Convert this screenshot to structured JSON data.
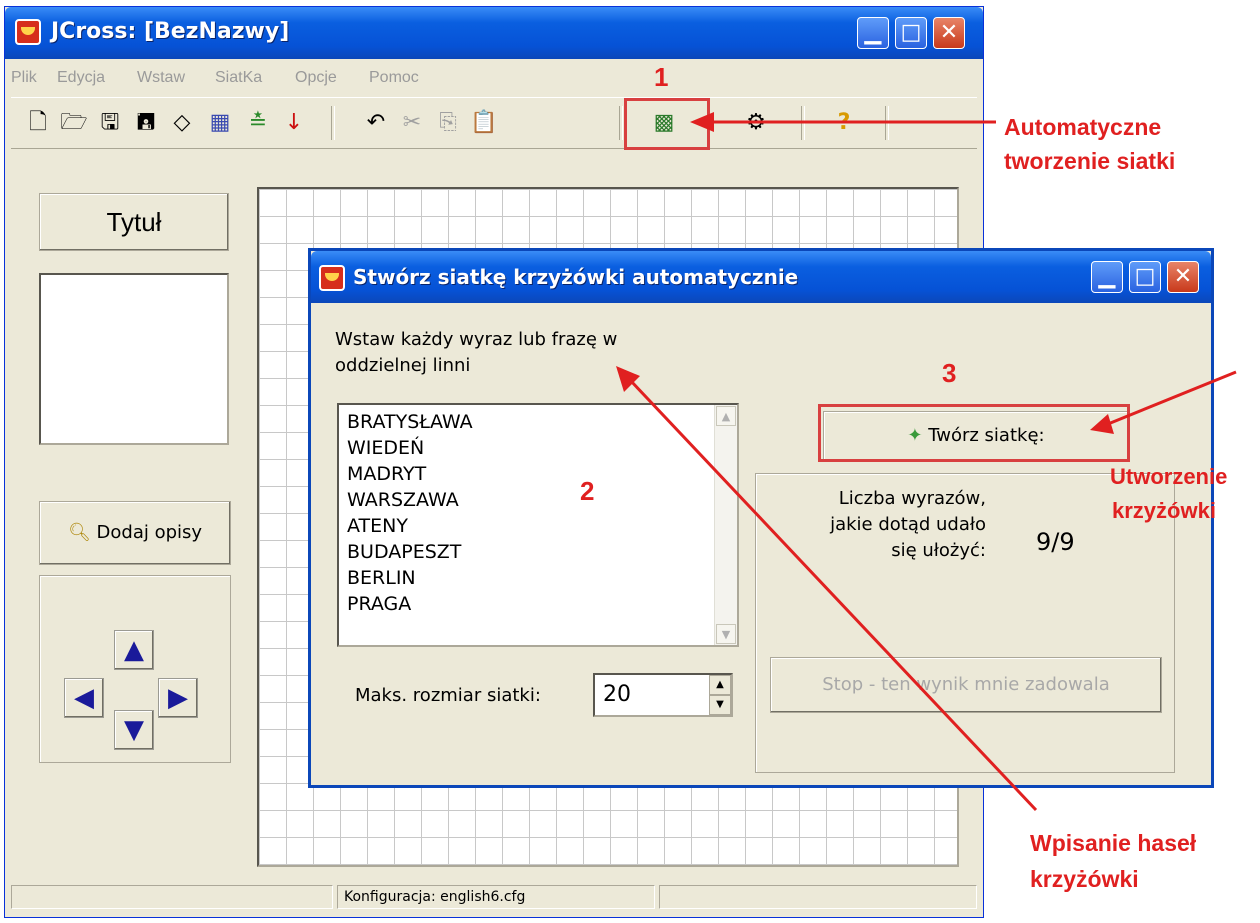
{
  "main_window": {
    "title": "JCross: [BezNazwy]",
    "menu": [
      "Plik",
      "Edycja",
      "Wstaw",
      "SiatKa",
      "Opcje",
      "Pomoc"
    ],
    "toolbar_icons": [
      "new-file-icon",
      "open-folder-icon",
      "save-icon",
      "save-as-icon",
      "eraser-icon",
      "grid-pattern-icon",
      "spacing-icon",
      "arrow-down-icon",
      "undo-icon",
      "cut-icon",
      "copy-icon",
      "paste-icon",
      "auto-grid-icon",
      "settings-icon",
      "help-icon"
    ],
    "title_button": "Tytuł",
    "add_descriptions_button": "Dodaj opisy",
    "status": "Konfiguracja: english6.cfg"
  },
  "dialog": {
    "title": "Stwórz siatkę krzyżówki automatycznie",
    "instructions_line1": "Wstaw każdy wyraz lub frazę w",
    "instructions_line2": "oddzielnej linni",
    "words": [
      "BRATYSŁAWA",
      "WIEDEŃ",
      "MADRYT",
      "WARSZAWA",
      "ATENY",
      "BUDAPESZT",
      "BERLIN",
      "PRAGA"
    ],
    "max_size_label": "Maks. rozmiar siatki:",
    "max_size_value": "20",
    "create_button": "Twórz siatkę:",
    "count_label_line1": "Liczba wyrazów,",
    "count_label_line2": "jakie dotąd udało",
    "count_label_line3": "się ułożyć:",
    "count_value": "9/9",
    "stop_button": "Stop - ten wynik mnie zadowala"
  },
  "annotations": {
    "step1": "1",
    "step2": "2",
    "step3": "3",
    "auto_grid_line1": "Automatyczne",
    "auto_grid_line2": "tworzenie siatki",
    "create_crossword_line1": "Utworzenie",
    "create_crossword_line2": "krzyżówki",
    "enter_words_line1": "Wpisanie haseł",
    "enter_words_line2": "krzyżówki",
    "color": "#e02020"
  }
}
